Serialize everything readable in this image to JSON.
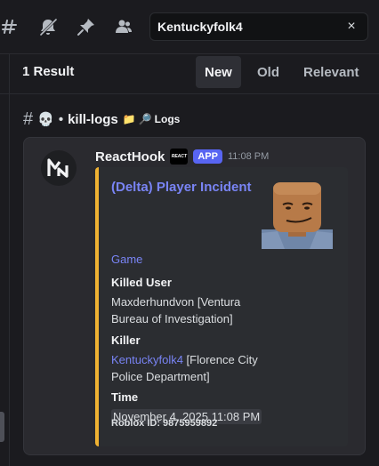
{
  "toolbar": {
    "icons": [
      "threads-icon",
      "notifications-muted-icon",
      "pin-icon",
      "members-icon"
    ]
  },
  "search": {
    "value": "Kentuckyfolk4",
    "clear_icon": "×"
  },
  "results": {
    "count_label": "1 Result",
    "sort_tabs": [
      {
        "label": "New",
        "active": true
      },
      {
        "label": "Old",
        "active": false
      },
      {
        "label": "Relevant",
        "active": false
      }
    ]
  },
  "channel": {
    "hash": "#",
    "emoji": "💀",
    "separator": "•",
    "name": "kill-logs",
    "category_icon": "📁",
    "category_emoji": "🔎",
    "category": "Logs"
  },
  "message": {
    "author": "ReactHook",
    "server_tag": "REACT",
    "badge": "APP",
    "timestamp": "11:08 PM",
    "embed": {
      "accent_color": "#f0b232",
      "title": "(Delta) Player Incident",
      "description": "Game",
      "fields": [
        {
          "name": "Killed User",
          "value": "Maxderhundvon [Ventura Bureau of Investigation]"
        },
        {
          "name": "Killer",
          "link": "Kentuckyfolk4",
          "value": " [Florence City Police Department]"
        },
        {
          "name": "Time",
          "value": "November 4, 2025 11:08 PM"
        }
      ],
      "footer": "Roblox ID: 9875959892"
    }
  },
  "colors": {
    "background": "#1b1b1f",
    "link": "#7984f5",
    "app_badge": "#5865f2"
  }
}
